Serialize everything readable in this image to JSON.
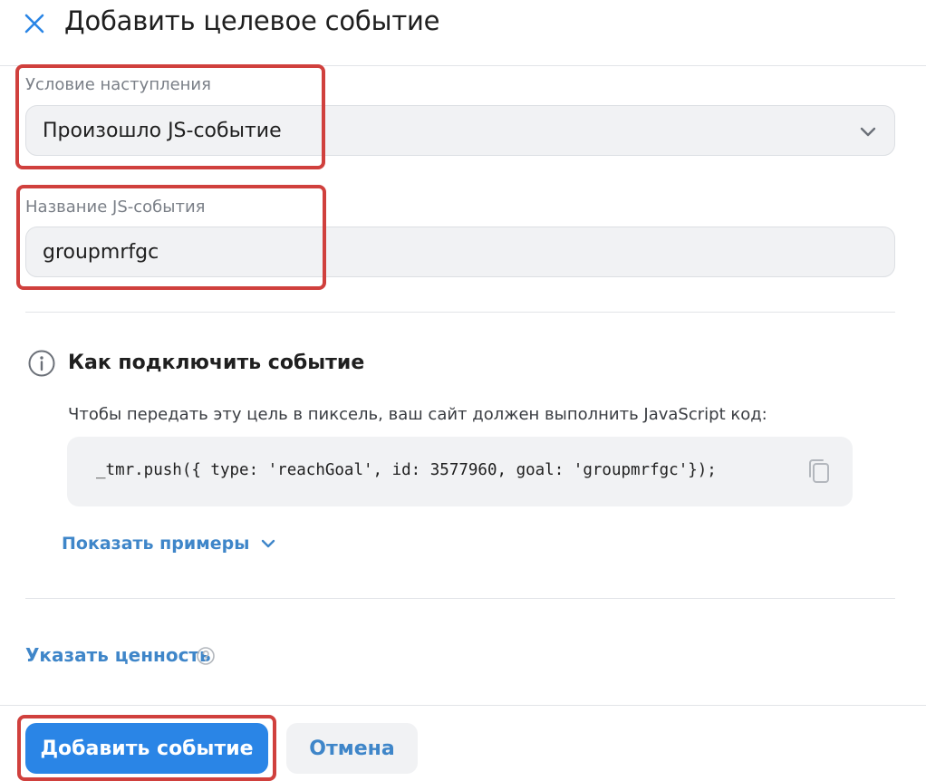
{
  "header": {
    "title": "Добавить целевое событие",
    "close_icon": "close-icon"
  },
  "condition_field": {
    "label": "Условие наступления",
    "value": "Произошло JS-событие",
    "icon": "chevron-down-icon"
  },
  "js_event_field": {
    "label": "Название JS-события",
    "value": "groupmrfgc"
  },
  "info": {
    "title": "Как подключить событие",
    "description": "Чтобы передать эту цель в пиксель, ваш сайт должен выполнить JavaScript код:",
    "code": "_tmr.push({ type: 'reachGoal', id: 3577960, goal: 'groupmrfgc'});",
    "info_icon": "info-icon",
    "copy_icon": "copy-icon"
  },
  "show_examples": {
    "label": "Показать примеры",
    "icon": "chevron-down-icon"
  },
  "value_link": {
    "label": "Указать ценность",
    "icon": "help-icon"
  },
  "footer": {
    "primary_label": "Добавить событие",
    "secondary_label": "Отмена"
  },
  "colors": {
    "accent": "#2a85e6",
    "link": "#3f86c9",
    "annotation": "#d0403d",
    "field_bg": "#f1f2f4"
  }
}
